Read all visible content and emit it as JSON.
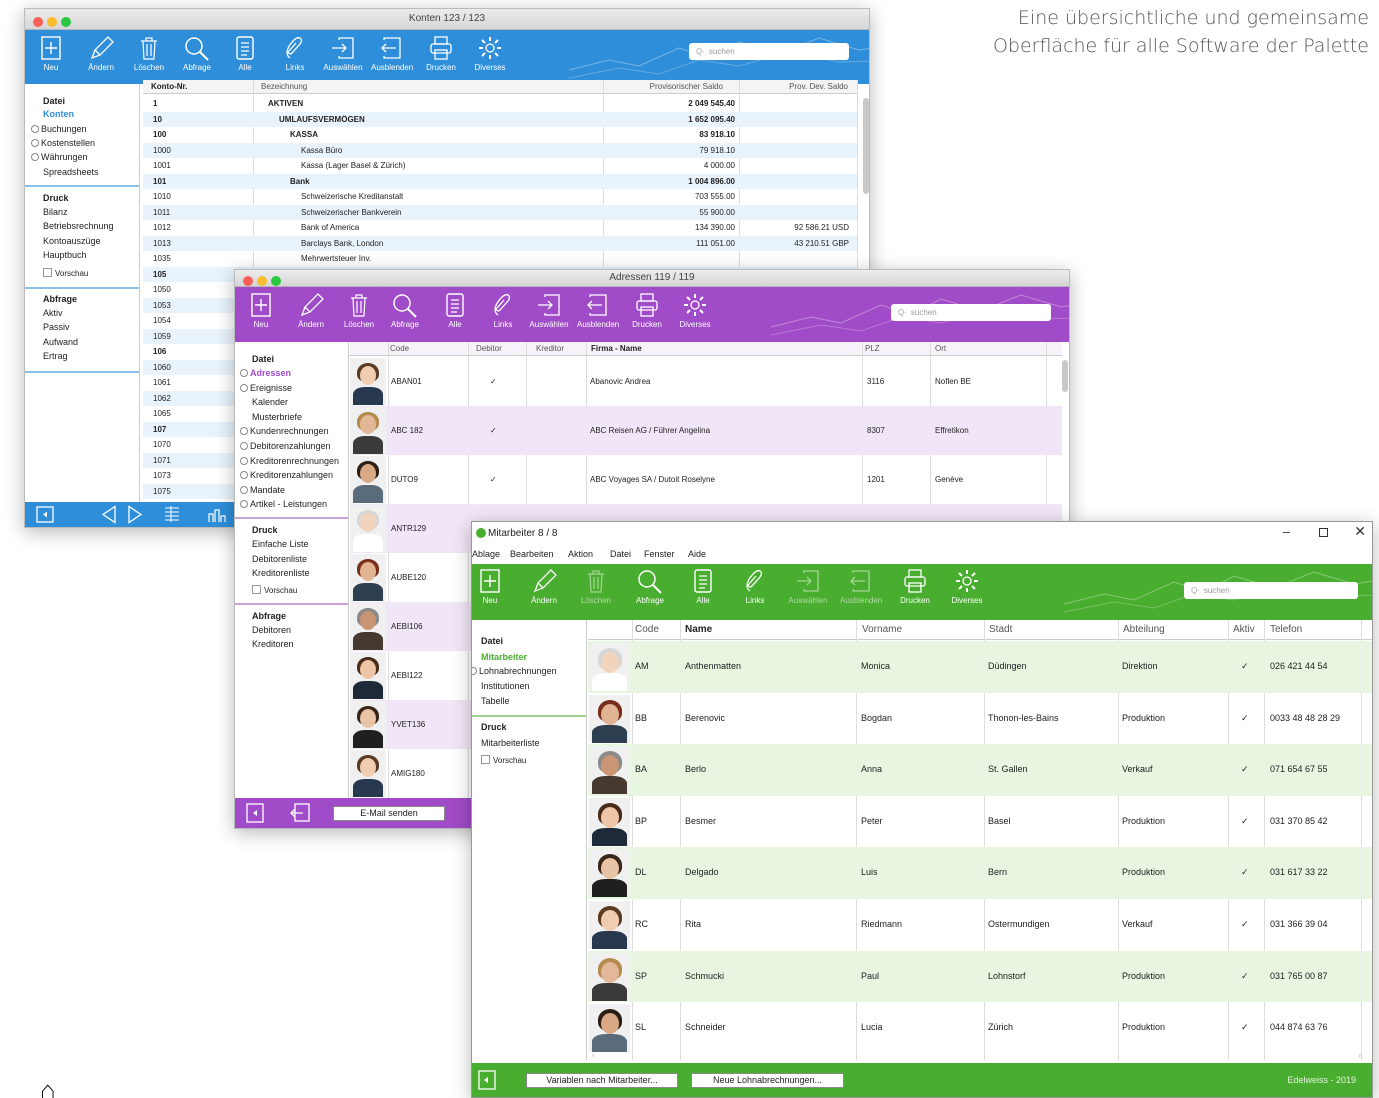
{
  "tagline": [
    "Eine übersichtliche und gemeinsame",
    "Oberfläche für alle Software der Palette"
  ],
  "colors": {
    "blue": "#2e8ed9",
    "purple": "#a04bc7",
    "green": "#49ad2f"
  },
  "toolbar_labels": {
    "neu": "Neu",
    "aendern": "Ändern",
    "loeschen": "Löschen",
    "abfrage": "Abfrage",
    "alle": "Alle",
    "links": "Links",
    "auswaehlen": "Auswählen",
    "ausblenden": "Ausblenden",
    "drucken": "Drucken",
    "diverses": "Diverses",
    "search_placeholder": "suchen"
  },
  "w1": {
    "title": "Konten  123 / 123",
    "sidebar": [
      {
        "label": "Datei",
        "style": "bold"
      },
      {
        "label": "Konten",
        "style": "active"
      },
      {
        "label": "Buchungen",
        "clip": true
      },
      {
        "label": "Kostenstellen",
        "clip": true
      },
      {
        "label": "Währungen",
        "clip": true
      },
      {
        "label": "Spreadsheets"
      },
      {
        "label": "Druck",
        "style": "bold"
      },
      {
        "label": "Bilanz"
      },
      {
        "label": "Betriebsrechnung"
      },
      {
        "label": "Kontoauszüge"
      },
      {
        "label": "Hauptbuch"
      },
      {
        "label": "Vorschau",
        "check": true
      },
      {
        "label": "Abfrage",
        "style": "bold"
      },
      {
        "label": "Aktiv"
      },
      {
        "label": "Passiv"
      },
      {
        "label": "Aufwand"
      },
      {
        "label": "Ertrag"
      }
    ],
    "columns": [
      "Konto-Nr.",
      "Bezeichnung",
      "Provisorischer Saldo",
      "Prov. Dev. Saldo"
    ],
    "rows": [
      {
        "nr": "1",
        "name": "AKTIVEN",
        "saldo": "2 049 545.40",
        "dev": "",
        "b": true,
        "ind": 0
      },
      {
        "nr": "10",
        "name": "UMLAUFSVERMÖGEN",
        "saldo": "1 652 095.40",
        "dev": "",
        "b": true,
        "ind": 1
      },
      {
        "nr": "100",
        "name": "KASSA",
        "saldo": "83 918.10",
        "dev": "",
        "b": true,
        "ind": 2
      },
      {
        "nr": "1000",
        "name": "Kassa Büro",
        "saldo": "79 918.10",
        "dev": "",
        "b": false,
        "ind": 3
      },
      {
        "nr": "1001",
        "name": "Kassa (Lager Basel & Zürich)",
        "saldo": "4 000.00",
        "dev": "",
        "b": false,
        "ind": 3
      },
      {
        "nr": "101",
        "name": "Bank",
        "saldo": "1 004 896.00",
        "dev": "",
        "b": true,
        "ind": 2
      },
      {
        "nr": "1010",
        "name": "Schweizerische Kreditanstalt",
        "saldo": "703 555.00",
        "dev": "",
        "b": false,
        "ind": 3
      },
      {
        "nr": "1011",
        "name": "Schweizerischer Bankverein",
        "saldo": "55 900.00",
        "dev": "",
        "b": false,
        "ind": 3
      },
      {
        "nr": "1012",
        "name": "Bank of America",
        "saldo": "134 390.00",
        "dev": "92 586.21 USD",
        "b": false,
        "ind": 3
      },
      {
        "nr": "1013",
        "name": "Barclays Bank, London",
        "saldo": "111 051.00",
        "dev": "43 210.51 GBP",
        "b": false,
        "ind": 3
      },
      {
        "nr": "1035",
        "name": "Mehrwertsteuer Inv.",
        "saldo": "",
        "dev": "",
        "b": false,
        "ind": 3
      },
      {
        "nr": "105",
        "name": "",
        "saldo": "",
        "dev": "",
        "b": true,
        "ind": 0
      },
      {
        "nr": "1050",
        "name": "",
        "saldo": "",
        "dev": "",
        "b": false,
        "ind": 0
      },
      {
        "nr": "1053",
        "name": "",
        "saldo": "",
        "dev": "",
        "b": false,
        "ind": 0
      },
      {
        "nr": "1054",
        "name": "",
        "saldo": "",
        "dev": "",
        "b": false,
        "ind": 0
      },
      {
        "nr": "1059",
        "name": "",
        "saldo": "",
        "dev": "",
        "b": false,
        "ind": 0
      },
      {
        "nr": "106",
        "name": "",
        "saldo": "",
        "dev": "",
        "b": true,
        "ind": 0
      },
      {
        "nr": "1060",
        "name": "",
        "saldo": "",
        "dev": "",
        "b": false,
        "ind": 0
      },
      {
        "nr": "1061",
        "name": "",
        "saldo": "",
        "dev": "",
        "b": false,
        "ind": 0
      },
      {
        "nr": "1062",
        "name": "",
        "saldo": "",
        "dev": "",
        "b": false,
        "ind": 0
      },
      {
        "nr": "1065",
        "name": "",
        "saldo": "",
        "dev": "",
        "b": false,
        "ind": 0
      },
      {
        "nr": "107",
        "name": "",
        "saldo": "",
        "dev": "",
        "b": true,
        "ind": 0
      },
      {
        "nr": "1070",
        "name": "",
        "saldo": "",
        "dev": "",
        "b": false,
        "ind": 0
      },
      {
        "nr": "1071",
        "name": "",
        "saldo": "",
        "dev": "",
        "b": false,
        "ind": 0
      },
      {
        "nr": "1073",
        "name": "",
        "saldo": "",
        "dev": "",
        "b": false,
        "ind": 0
      },
      {
        "nr": "1075",
        "name": "",
        "saldo": "",
        "dev": "",
        "b": false,
        "ind": 0
      }
    ]
  },
  "w2": {
    "title": "Adressen  119 / 119",
    "sidebar": [
      {
        "label": "Datei",
        "style": "bold"
      },
      {
        "label": "Adressen",
        "style": "active",
        "clip": true
      },
      {
        "label": "Ereignisse",
        "clip": true
      },
      {
        "label": "Kalender"
      },
      {
        "label": "Musterbriefe"
      },
      {
        "label": "Kundenrechnungen",
        "clip": true
      },
      {
        "label": "Debitorenzahlungen",
        "clip": true
      },
      {
        "label": "Kreditorenrechnungen",
        "clip": true
      },
      {
        "label": "Kreditorenzahlungen",
        "clip": true
      },
      {
        "label": "Mandate",
        "clip": true
      },
      {
        "label": "Artikel - Leistungen",
        "clip": true
      },
      {
        "label": "Druck",
        "style": "bold"
      },
      {
        "label": "Einfache Liste"
      },
      {
        "label": "Debitorenliste"
      },
      {
        "label": "Kreditorenliste"
      },
      {
        "label": "Vorschau",
        "check": true
      },
      {
        "label": "Abfrage",
        "style": "bold"
      },
      {
        "label": "Debitoren"
      },
      {
        "label": "Kreditoren"
      }
    ],
    "columns": [
      "Code",
      "Debitor",
      "Kreditor",
      "Firma - Name",
      "PLZ",
      "Ort"
    ],
    "rows": [
      {
        "code": "ABAN01",
        "deb": "✓",
        "kred": "",
        "name": "Abanovic Andrea",
        "plz": "3116",
        "ort": "Noflen BE"
      },
      {
        "code": "ABC 182",
        "deb": "✓",
        "kred": "",
        "name": "ABC Reisen AG / Führer Angelina",
        "plz": "8307",
        "ort": "Effretikon"
      },
      {
        "code": "DUTO9",
        "deb": "✓",
        "kred": "",
        "name": "ABC Voyages SA / Dutoit Roselyne",
        "plz": "1201",
        "ort": "Genève"
      },
      {
        "code": "ANTR129",
        "deb": "",
        "kred": "",
        "name": "",
        "plz": "",
        "ort": ""
      },
      {
        "code": "AUBE120",
        "deb": "",
        "kred": "",
        "name": "",
        "plz": "",
        "ort": ""
      },
      {
        "code": "AEBI106",
        "deb": "",
        "kred": "",
        "name": "",
        "plz": "",
        "ort": ""
      },
      {
        "code": "AEBI122",
        "deb": "",
        "kred": "",
        "name": "",
        "plz": "",
        "ort": ""
      },
      {
        "code": "YVET136",
        "deb": "",
        "kred": "",
        "name": "",
        "plz": "",
        "ort": ""
      },
      {
        "code": "AMIG180",
        "deb": "",
        "kred": "",
        "name": "",
        "plz": "",
        "ort": ""
      }
    ],
    "email_button": "E-Mail senden"
  },
  "w3": {
    "title": "Mitarbeiter  8 / 8",
    "menu": [
      "Ablage",
      "Bearbeiten",
      "Aktion",
      "Datei",
      "Fenster",
      "Aide"
    ],
    "sidebar": [
      {
        "label": "Datei",
        "style": "bold"
      },
      {
        "label": "Mitarbeiter",
        "style": "active"
      },
      {
        "label": "Lohnabrechnungen",
        "clip": true
      },
      {
        "label": "Institutionen"
      },
      {
        "label": "Tabelle"
      },
      {
        "label": "Druck",
        "style": "bold"
      },
      {
        "label": "Mitarbeiterliste"
      },
      {
        "label": "Vorschau",
        "check": true
      }
    ],
    "columns": [
      "Code",
      "Name",
      "Vorname",
      "Stadt",
      "Abteilung",
      "Aktiv",
      "Telefon"
    ],
    "rows": [
      {
        "code": "AM",
        "name": "Anthenmatten",
        "vorname": "Monica",
        "stadt": "Düdingen",
        "abt": "Direktion",
        "aktiv": "✓",
        "tel": "026 421 44 54"
      },
      {
        "code": "BB",
        "name": "Berenovic",
        "vorname": "Bogdan",
        "stadt": "Thonon-les-Bains",
        "abt": "Produktion",
        "aktiv": "✓",
        "tel": "0033 48 48 28 29"
      },
      {
        "code": "BA",
        "name": "Berlo",
        "vorname": "Anna",
        "stadt": "St. Gallen",
        "abt": "Verkauf",
        "aktiv": "✓",
        "tel": "071 654 67 55"
      },
      {
        "code": "BP",
        "name": "Besmer",
        "vorname": "Peter",
        "stadt": "Basel",
        "abt": "Produktion",
        "aktiv": "✓",
        "tel": "031 370 85 42"
      },
      {
        "code": "DL",
        "name": "Delgado",
        "vorname": "Luis",
        "stadt": "Bern",
        "abt": "Produktion",
        "aktiv": "✓",
        "tel": "031 617 33 22"
      },
      {
        "code": "RC",
        "name": "Rita",
        "vorname": "Riedmann",
        "stadt": "Ostermundigen",
        "abt": "Verkauf",
        "aktiv": "✓",
        "tel": "031 366 39 04"
      },
      {
        "code": "SP",
        "name": "Schmucki",
        "vorname": "Paul",
        "stadt": "Lohnstorf",
        "abt": "Produktion",
        "aktiv": "✓",
        "tel": "031 765 00 87"
      },
      {
        "code": "SL",
        "name": "Schneider",
        "vorname": "Lucia",
        "stadt": "Zürich",
        "abt": "Produktion",
        "aktiv": "✓",
        "tel": "044 874 63 76"
      }
    ],
    "buttons": [
      "Variablen nach Mitarbeiter...",
      "Neue Lohnabrechnungen..."
    ],
    "footer": "Edelweiss - 2019"
  }
}
